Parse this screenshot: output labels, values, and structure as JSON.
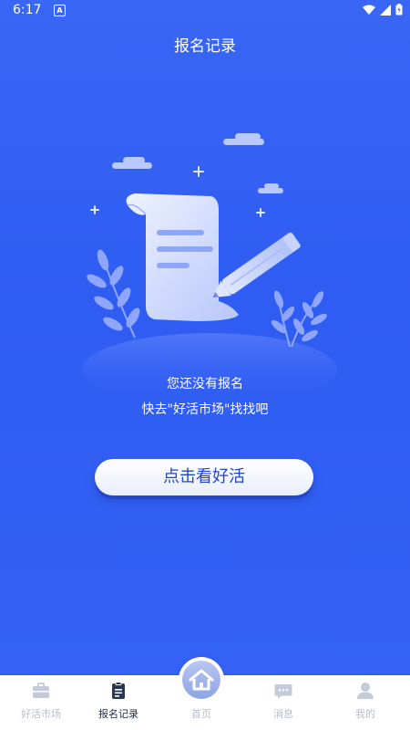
{
  "status_bar": {
    "time": "6:17",
    "notification_icon": "A"
  },
  "header": {
    "title": "报名记录"
  },
  "empty_state": {
    "line1": "您还没有报名",
    "line2": "快去\"好活市场\"找找吧",
    "illustration": "scroll-with-pencil"
  },
  "cta": {
    "label": "点击看好活"
  },
  "tabs": [
    {
      "label": "好活市场",
      "icon": "briefcase-icon",
      "active": false
    },
    {
      "label": "报名记录",
      "icon": "clipboard-icon",
      "active": true
    },
    {
      "label": "首页",
      "icon": "home-icon",
      "active": false
    },
    {
      "label": "消息",
      "icon": "chat-icon",
      "active": false
    },
    {
      "label": "我的",
      "icon": "user-icon",
      "active": false
    }
  ],
  "colors": {
    "background": "#3562f4",
    "accent": "#2246c9",
    "tab_inactive": "#b7bccb"
  }
}
